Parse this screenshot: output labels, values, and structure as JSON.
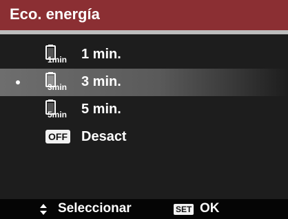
{
  "header": {
    "title": "Eco. energía"
  },
  "menu": {
    "items": [
      {
        "label": "1 min.",
        "icon": "battery-timer-1min-icon",
        "icon_text": "1min",
        "selected": false
      },
      {
        "label": "3 min.",
        "icon": "battery-timer-3min-icon",
        "icon_text": "3min",
        "selected": true
      },
      {
        "label": "5 min.",
        "icon": "battery-timer-5min-icon",
        "icon_text": "5min",
        "selected": false
      },
      {
        "label": "Desact",
        "icon": "off-icon",
        "icon_text": "OFF",
        "selected": false
      }
    ]
  },
  "footer": {
    "select_hint": "Seleccionar",
    "set_badge": "SET",
    "ok_hint": "OK",
    "select_icon": "up-down-arrows-icon"
  },
  "colors": {
    "title_bar": "#8b2f33",
    "selected_row": "#6e6e6e",
    "background": "#1d1d1d",
    "footer": "#050505"
  }
}
